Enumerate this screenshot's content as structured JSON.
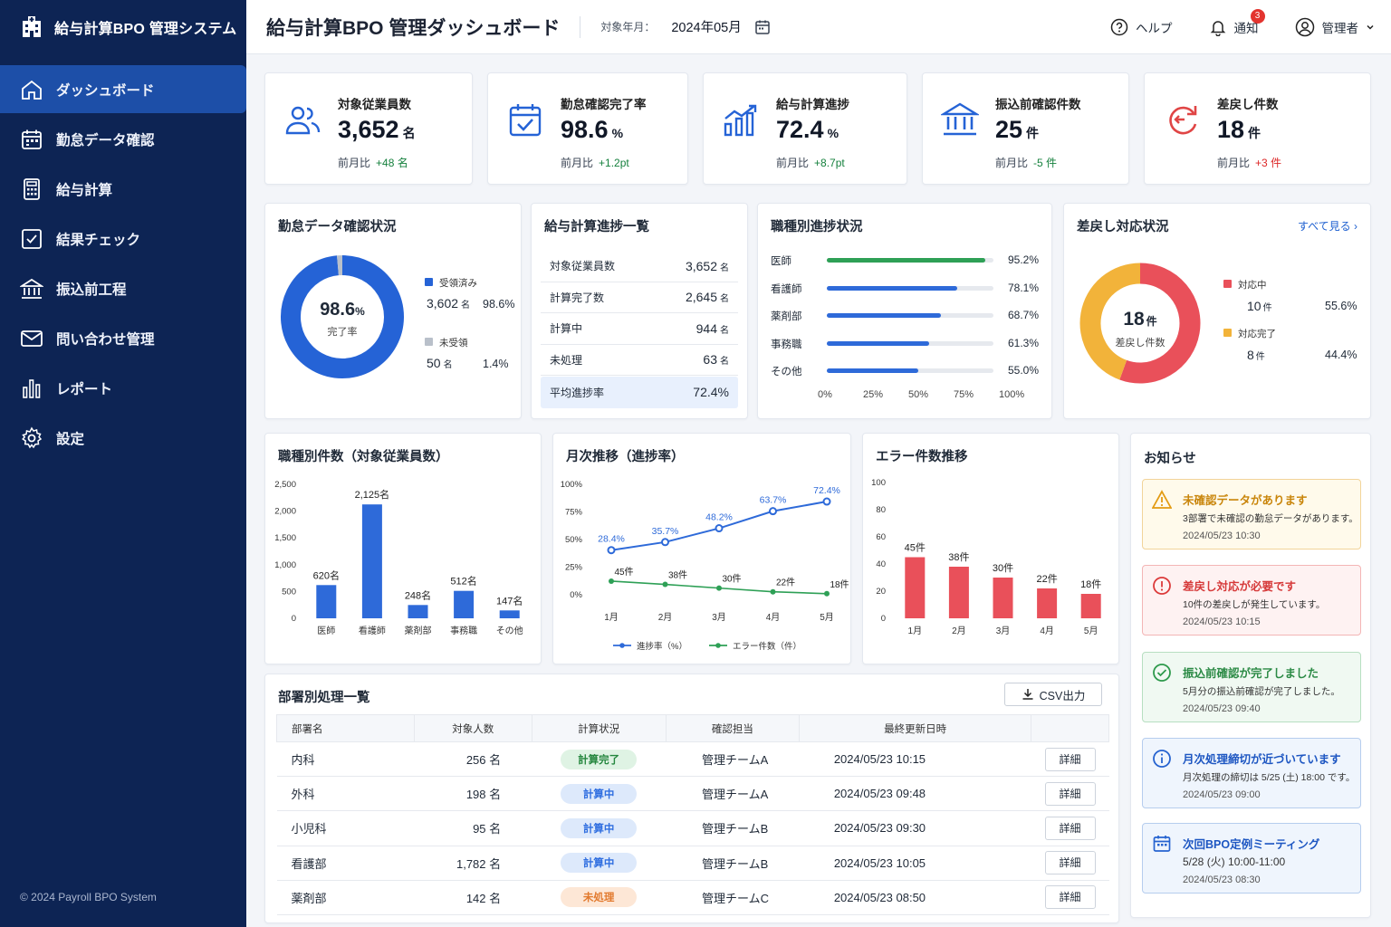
{
  "app": {
    "title": "給与計算BPO 管理システム",
    "copyright": "© 2024 Payroll BPO System"
  },
  "nav": [
    {
      "label": "ダッシュボード",
      "icon": "home-icon"
    },
    {
      "label": "勤怠データ確認",
      "icon": "calendar-icon"
    },
    {
      "label": "給与計算",
      "icon": "calculator-icon"
    },
    {
      "label": "結果チェック",
      "icon": "checklist-icon"
    },
    {
      "label": "振込前工程",
      "icon": "bank-icon"
    },
    {
      "label": "問い合わせ管理",
      "icon": "mail-icon"
    },
    {
      "label": "レポート",
      "icon": "bar-chart-icon"
    },
    {
      "label": "設定",
      "icon": "gear-icon"
    }
  ],
  "header": {
    "title": "給与計算BPO 管理ダッシュボード",
    "period_label": "対象年月：",
    "period_value": "2024年05月",
    "help": "ヘルプ",
    "notify": "通知",
    "notify_count": "3",
    "user": "管理者"
  },
  "kpis": [
    {
      "label": "対象従業員数",
      "value": "3,652",
      "unit": "名",
      "cmp_label": "前月比",
      "cmp_value": "+48 名",
      "tone": "green",
      "icon": "users-icon"
    },
    {
      "label": "勤怠確認完了率",
      "value": "98.6",
      "unit": "%",
      "cmp_label": "前月比",
      "cmp_value": "+1.2pt",
      "tone": "green",
      "icon": "calendar-check-icon"
    },
    {
      "label": "給与計算進捗",
      "value": "72.4",
      "unit": "%",
      "cmp_label": "前月比",
      "cmp_value": "+8.7pt",
      "tone": "green",
      "icon": "growth-chart-icon"
    },
    {
      "label": "振込前確認件数",
      "value": "25",
      "unit": "件",
      "cmp_label": "前月比",
      "cmp_value": "-5 件",
      "tone": "green",
      "icon": "bank-icon"
    },
    {
      "label": "差戻し件数",
      "value": "18",
      "unit": "件",
      "cmp_label": "前月比",
      "cmp_value": "+3 件",
      "tone": "red",
      "icon": "return-icon"
    }
  ],
  "attendance": {
    "title": "勤怠データ確認状況",
    "center_value": "98.6",
    "center_unit": "%",
    "center_label": "完了率",
    "items": [
      {
        "name": "受領済み",
        "count": "3,602",
        "unit": "名",
        "pct": "98.6%",
        "color": "#2563d6"
      },
      {
        "name": "未受領",
        "count": "50",
        "unit": "名",
        "pct": "1.4%",
        "color": "#b9c0ca"
      }
    ]
  },
  "progress": {
    "title": "給与計算進捗一覧",
    "rows": [
      {
        "label": "対象従業員数",
        "value": "3,652",
        "unit": "名"
      },
      {
        "label": "計算完了数",
        "value": "2,645",
        "unit": "名"
      },
      {
        "label": "計算中",
        "value": "944",
        "unit": "名"
      },
      {
        "label": "未処理",
        "value": "63",
        "unit": "名"
      },
      {
        "label": "平均進捗率",
        "value": "72.4%",
        "unit": ""
      }
    ]
  },
  "occupation_progress": {
    "title": "職種別進捗状況",
    "rows": [
      {
        "label": "医師",
        "value": 95.2,
        "text": "95.2%",
        "color": "#2ea056"
      },
      {
        "label": "看護師",
        "value": 78.1,
        "text": "78.1%",
        "color": "#2e6ad9"
      },
      {
        "label": "薬剤部",
        "value": 68.7,
        "text": "68.7%",
        "color": "#2e6ad9"
      },
      {
        "label": "事務職",
        "value": 61.3,
        "text": "61.3%",
        "color": "#2e6ad9"
      },
      {
        "label": "その他",
        "value": 55.0,
        "text": "55.0%",
        "color": "#2e6ad9"
      }
    ],
    "ticks": [
      "0%",
      "25%",
      "50%",
      "75%",
      "100%"
    ]
  },
  "returns": {
    "title": "差戻し対応状況",
    "link": "すべて見る ›",
    "center_value": "18",
    "center_unit": "件",
    "center_label": "差戻し件数",
    "items": [
      {
        "name": "対応中",
        "count": "10",
        "unit": "件",
        "pct": "55.6%",
        "value": 10,
        "color": "#e9505a"
      },
      {
        "name": "対応完了",
        "count": "8",
        "unit": "件",
        "pct": "44.4%",
        "value": 8,
        "color": "#f2b33a"
      }
    ]
  },
  "chart_data": [
    {
      "type": "bar",
      "title": "職種別件数（対象従業員数）",
      "categories": [
        "医師",
        "看護師",
        "薬剤部",
        "事務職",
        "その他"
      ],
      "values": [
        620,
        2125,
        248,
        512,
        147
      ],
      "labels": [
        "620名",
        "2,125名",
        "248名",
        "512名",
        "147名"
      ],
      "ylim": [
        0,
        2500
      ],
      "yticks": [
        "0",
        "500",
        "1,000",
        "1,500",
        "2,000",
        "2,500"
      ],
      "color": "#2e6ad9"
    },
    {
      "type": "line",
      "title": "月次推移（進捗率）",
      "categories": [
        "1月",
        "2月",
        "3月",
        "4月",
        "5月"
      ],
      "yticks": [
        "0%",
        "25%",
        "50%",
        "75%",
        "100%"
      ],
      "ylim": [
        0,
        100
      ],
      "series": [
        {
          "name": "進捗率（%）",
          "values": [
            28.4,
            35.7,
            48.2,
            63.7,
            72.4
          ],
          "labels": [
            "28.4%",
            "35.7%",
            "48.2%",
            "63.7%",
            "72.4%"
          ],
          "color": "#2e6ad9"
        },
        {
          "name": "エラー件数（件）",
          "values": [
            45,
            38,
            30,
            22,
            18
          ],
          "labels": [
            "45件",
            "38件",
            "30件",
            "22件",
            "18件"
          ],
          "color": "#2ea056"
        }
      ]
    },
    {
      "type": "bar",
      "title": "エラー件数推移",
      "categories": [
        "1月",
        "2月",
        "3月",
        "4月",
        "5月"
      ],
      "values": [
        45,
        38,
        30,
        22,
        18
      ],
      "labels": [
        "45件",
        "38件",
        "30件",
        "22件",
        "18件"
      ],
      "ylim": [
        0,
        100
      ],
      "yticks": [
        "0",
        "20",
        "40",
        "60",
        "80",
        "100"
      ],
      "color": "#e9505a"
    }
  ],
  "departments": {
    "title": "部署別処理一覧",
    "csv": "CSV出力",
    "headers": [
      "部署名",
      "対象人数",
      "計算状況",
      "確認担当",
      "最終更新日時"
    ],
    "detail": "詳細",
    "rows": [
      {
        "name": "内科",
        "count": "256 名",
        "status": "計算完了",
        "status_kind": "done",
        "owner": "管理チームA",
        "updated": "2024/05/23 10:15"
      },
      {
        "name": "外科",
        "count": "198 名",
        "status": "計算中",
        "status_kind": "calc",
        "owner": "管理チームA",
        "updated": "2024/05/23 09:48"
      },
      {
        "name": "小児科",
        "count": "95 名",
        "status": "計算中",
        "status_kind": "calc",
        "owner": "管理チームB",
        "updated": "2024/05/23 09:30"
      },
      {
        "name": "看護部",
        "count": "1,782 名",
        "status": "計算中",
        "status_kind": "calc",
        "owner": "管理チームB",
        "updated": "2024/05/23 10:05"
      },
      {
        "name": "薬剤部",
        "count": "142 名",
        "status": "未処理",
        "status_kind": "todo",
        "owner": "管理チームC",
        "updated": "2024/05/23 08:50"
      }
    ]
  },
  "notices": {
    "title": "お知らせ",
    "items": [
      {
        "title": "未確認データがあります",
        "body": "3部署で未確認の勤怠データがあります。",
        "date": "2024/05/23 10:30",
        "kind": "warning",
        "icon": "warning-icon"
      },
      {
        "title": "差戻し対応が必要です",
        "body": "10件の差戻しが発生しています。",
        "date": "2024/05/23 10:15",
        "kind": "error",
        "icon": "alert-icon"
      },
      {
        "title": "振込前確認が完了しました",
        "body": "5月分の振込前確認が完了しました。",
        "date": "2024/05/23 09:40",
        "kind": "success",
        "icon": "check-circle-icon"
      },
      {
        "title": "月次処理締切が近づいています",
        "body": "月次処理の締切は 5/25 (土) 18:00 です。",
        "date": "2024/05/23 09:00",
        "kind": "info",
        "icon": "info-icon"
      },
      {
        "title": "次回BPO定例ミーティング",
        "body": "5/28 (火) 10:00-11:00",
        "date": "2024/05/23 08:30",
        "kind": "info",
        "icon": "calendar-icon"
      }
    ]
  }
}
